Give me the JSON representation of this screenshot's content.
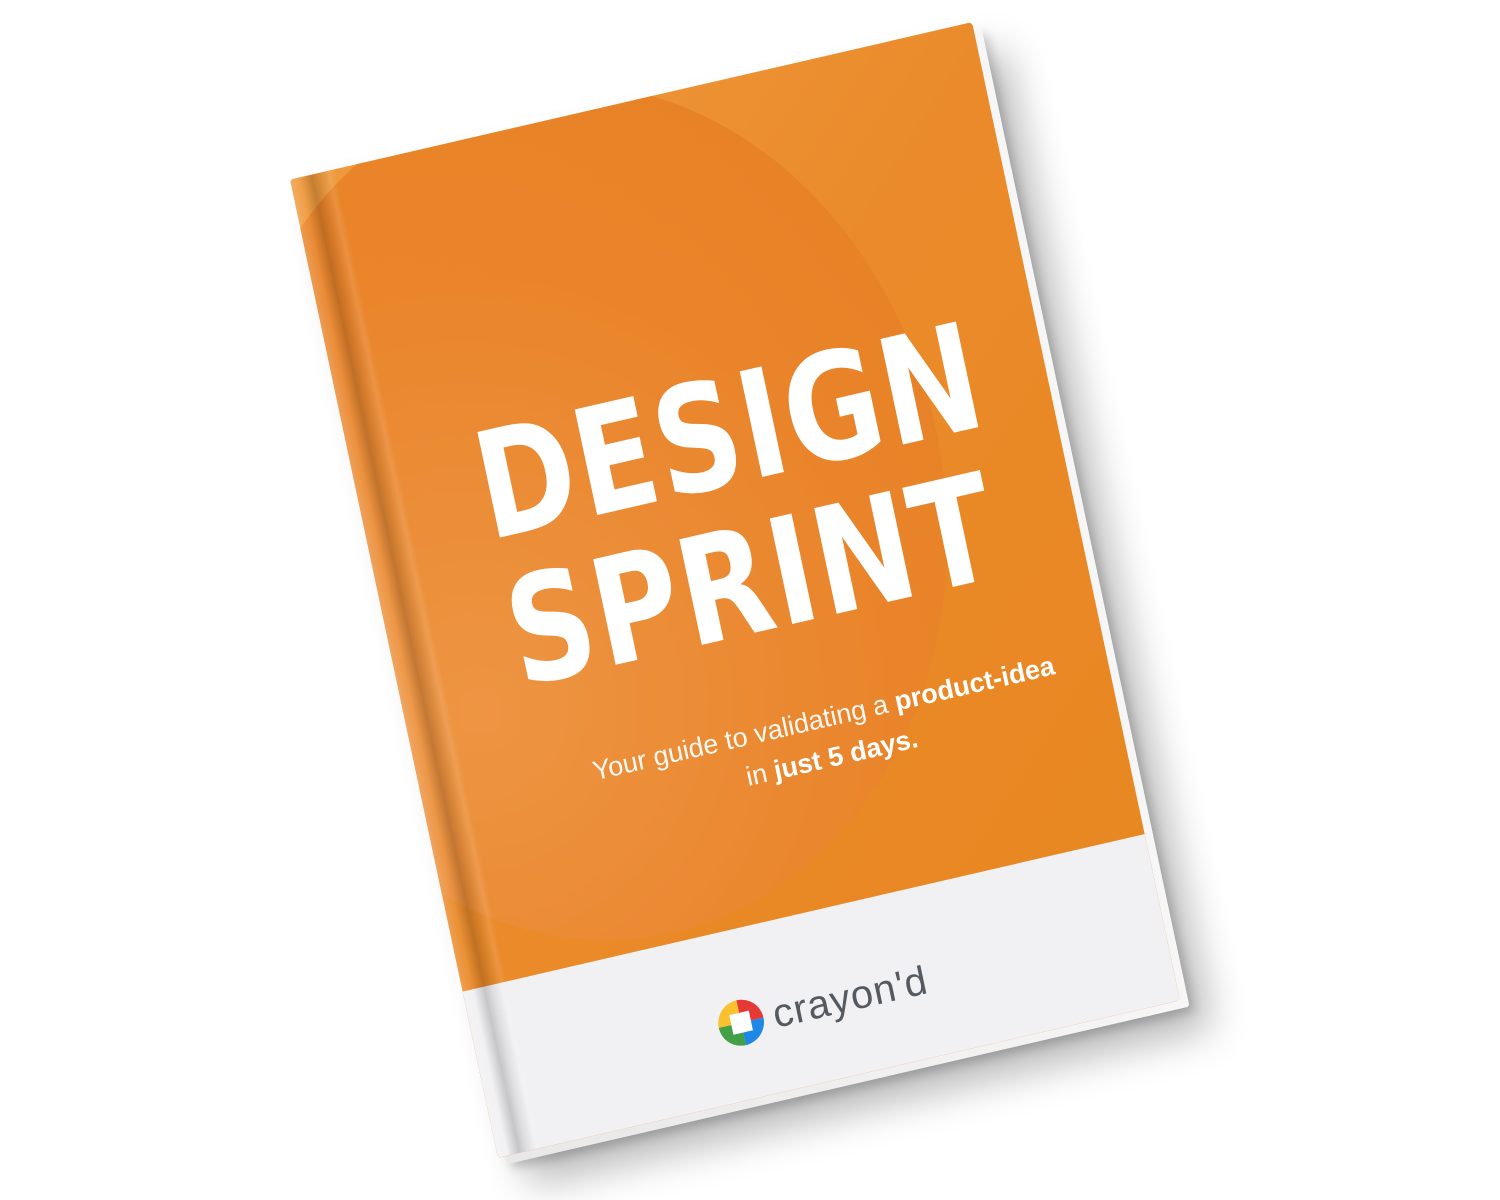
{
  "book": {
    "title_line1": "DESIGN",
    "title_line2": "SPRINT",
    "subtitle_part1": "Your guide to validating a ",
    "subtitle_bold1": "product-idea",
    "subtitle_part2": "in ",
    "subtitle_bold2": "just 5 days.",
    "brand": "crayon'd",
    "colors": {
      "cover": "#e98a25",
      "footer": "#f1f1f3",
      "text": "#ffffff"
    }
  }
}
